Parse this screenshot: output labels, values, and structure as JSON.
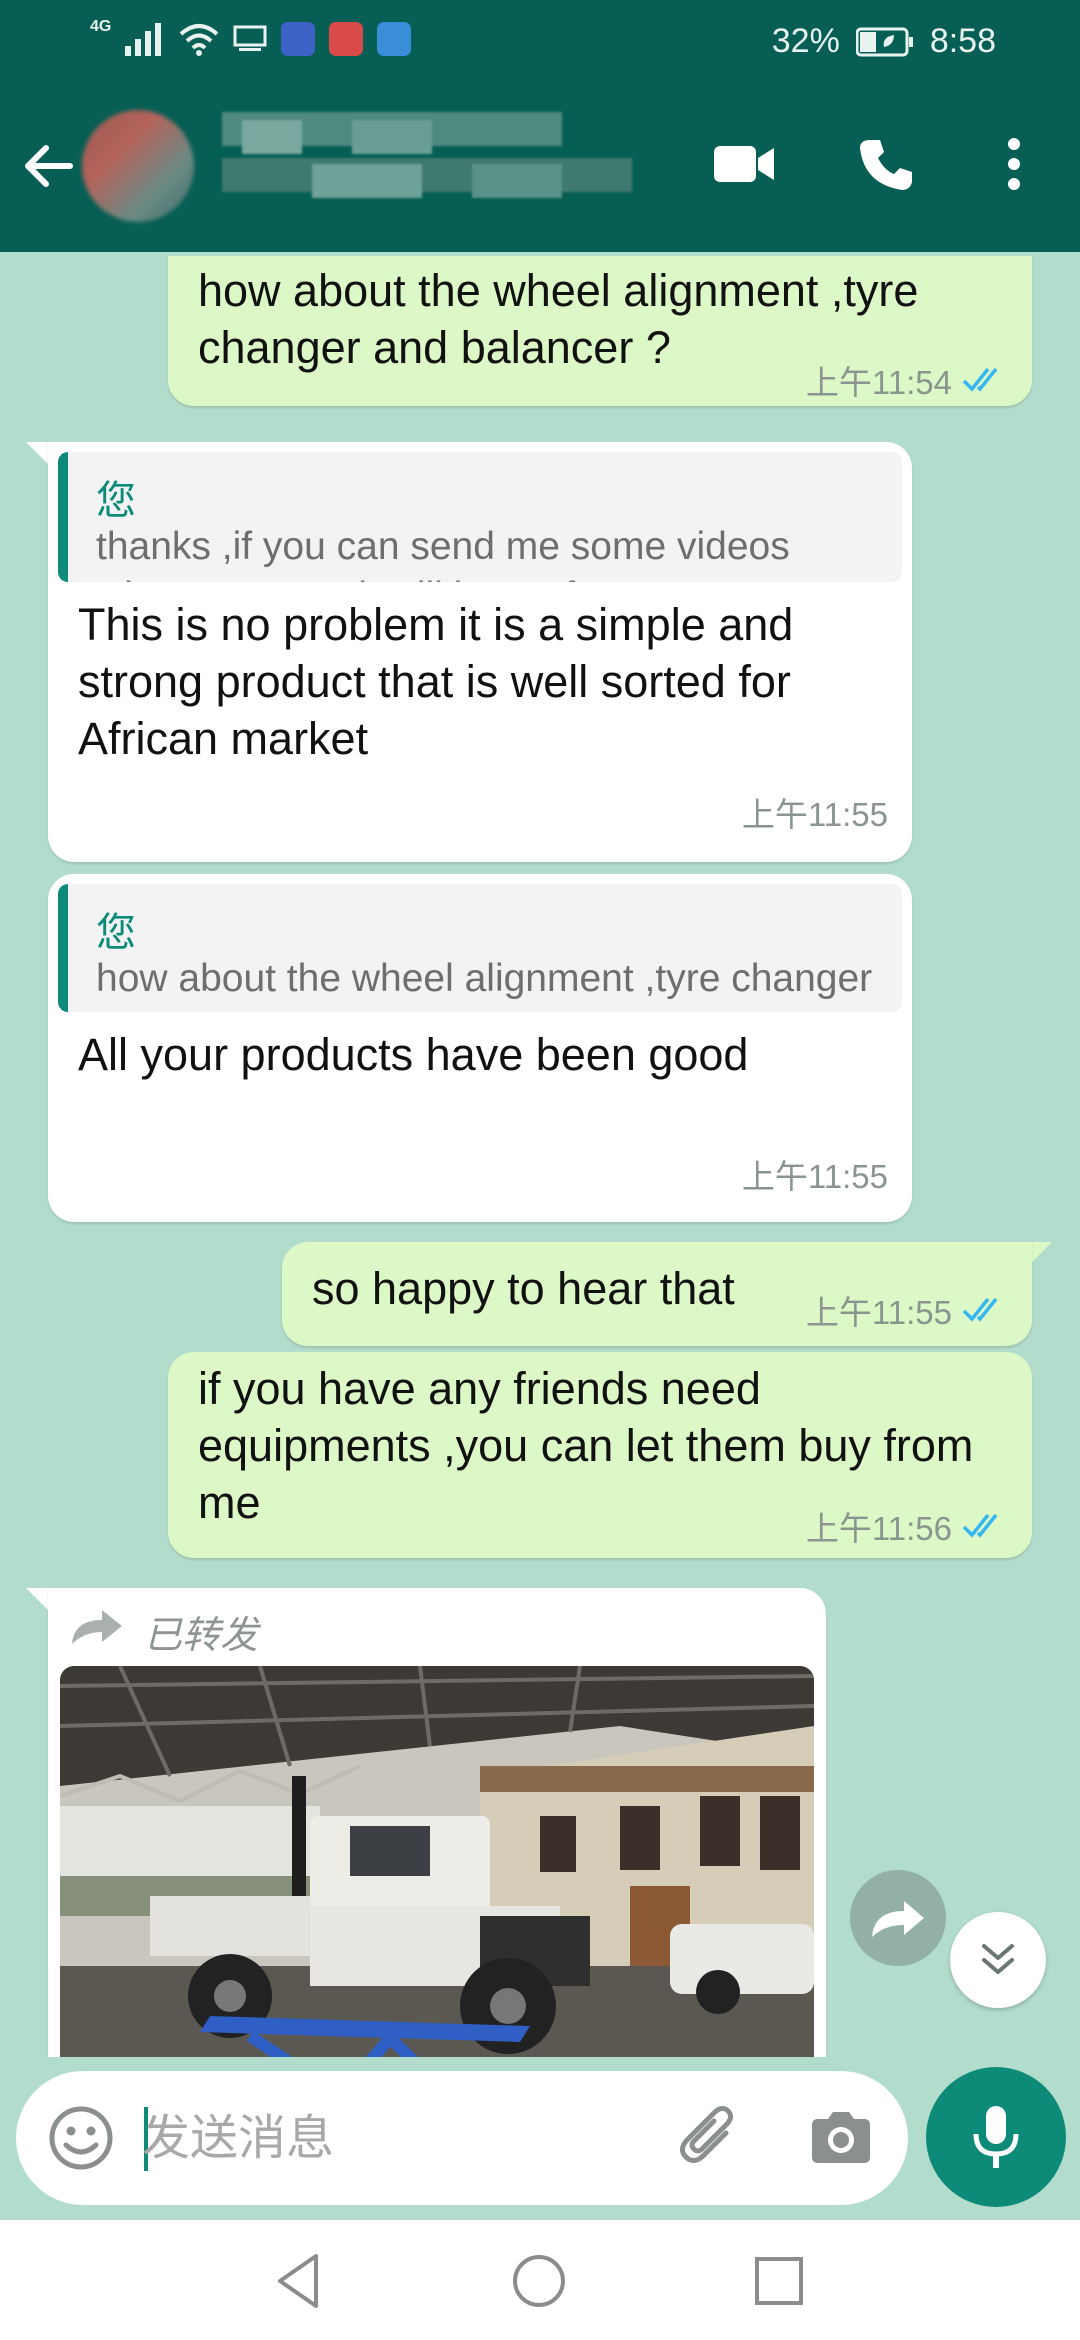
{
  "status_bar": {
    "network": "4G",
    "battery": "32%",
    "time": "8:58"
  },
  "colors": {
    "header": "#075e54",
    "chat_bg": "#b2dccb",
    "outgoing_bubble": "#dcf8c6",
    "incoming_bubble": "#ffffff",
    "accent": "#0e8a78",
    "read_ticks": "#34b7f1"
  },
  "messages": [
    {
      "direction": "out",
      "text": "how about the wheel alignment ,tyre changer and balancer ?",
      "time": "上午11:54",
      "status": "read"
    },
    {
      "direction": "in",
      "quote": {
        "author": "您",
        "text": "thanks ,if you can send me some videos when you use ,it will be perfect"
      },
      "text": "This is no problem it is a simple and strong product that is well sorted for African market",
      "time": "上午11:55"
    },
    {
      "direction": "in",
      "quote": {
        "author": "您",
        "text": "how about the wheel alignment ,tyre changer and balancer ?"
      },
      "text": "All your products have been good",
      "time": "上午11:55"
    },
    {
      "direction": "out",
      "text": "so happy to hear that",
      "time": "上午11:55",
      "status": "read"
    },
    {
      "direction": "out",
      "text": "if you have any friends need equipments ,you can let them buy from me",
      "time": "上午11:56",
      "status": "read"
    },
    {
      "direction": "in",
      "forwarded_label": "已转发",
      "media": "photo"
    }
  ],
  "input": {
    "placeholder": "发送消息"
  },
  "icons": {
    "back": "arrow-left-icon",
    "video_call": "video-camera-icon",
    "voice_call": "phone-icon",
    "menu": "more-vertical-icon",
    "emoji": "emoji-icon",
    "attach": "paperclip-icon",
    "camera": "camera-icon",
    "mic": "microphone-icon",
    "forward": "forward-arrow-icon",
    "scroll_down": "double-chevron-down-icon"
  }
}
